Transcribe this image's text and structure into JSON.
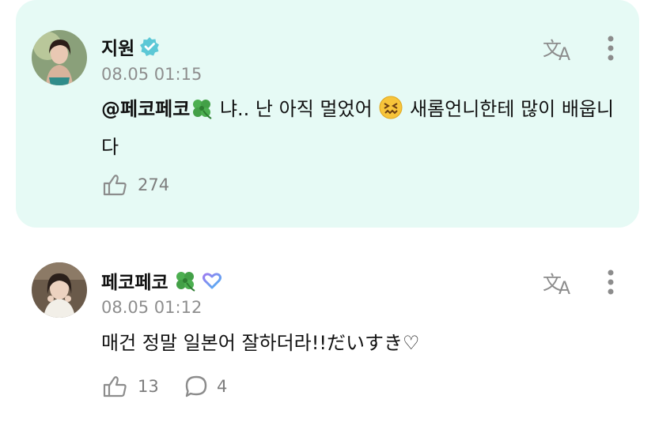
{
  "posts": [
    {
      "author": "지원",
      "verified_badge": "verified-check-icon",
      "timestamp": "08.05 01:15",
      "mention": "@페코페코",
      "mention_emoji": "four-leaf-clover-icon",
      "text_part1": "냐.. 난 아직 멀었어",
      "text_emoji": "confounded-face-icon",
      "text_part2": "새롬언니한테 많이 배웁니다",
      "likes": "274",
      "highlighted": true,
      "accent_color": "#e6faf5"
    },
    {
      "author": "페코페코",
      "author_emoji": "four-leaf-clover-icon",
      "badge": "heart-ring-icon",
      "timestamp": "08.05 01:12",
      "text": "매건 정말 일본어 잘하더라!!だいすき♡",
      "likes": "13",
      "comments": "4"
    }
  ],
  "actions": {
    "translate_icon": "translate-icon",
    "more_icon": "more-vertical-icon"
  }
}
